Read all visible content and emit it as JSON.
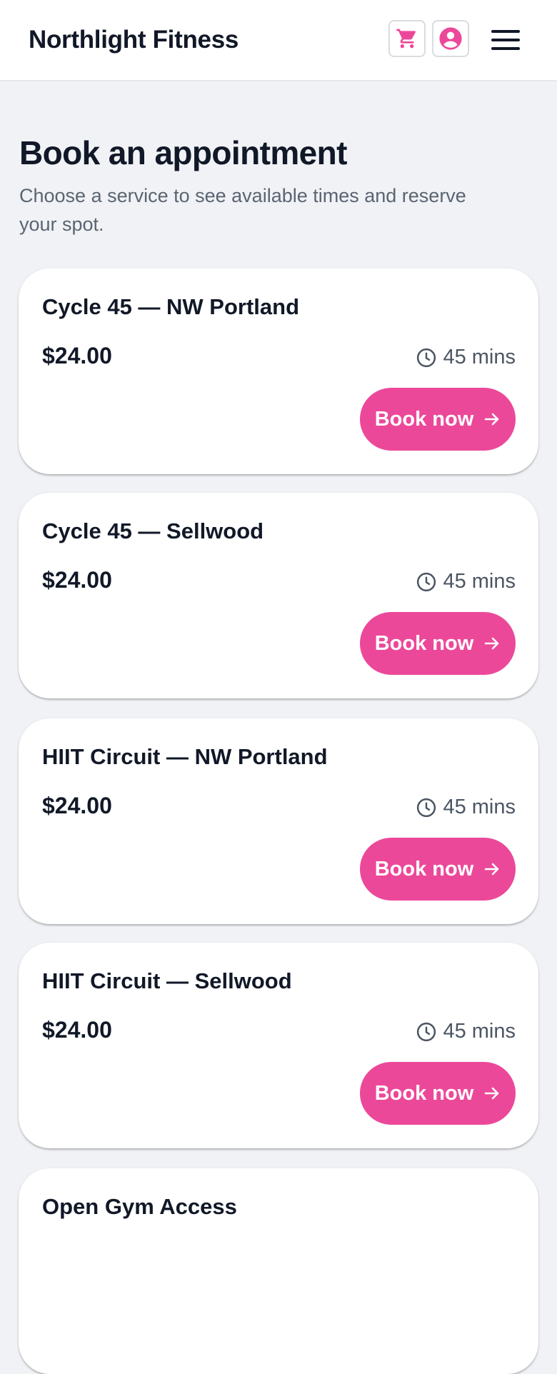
{
  "header": {
    "brand": "Northlight Fitness",
    "cart_icon": "cart-icon",
    "account_icon": "account-circle-icon",
    "menu_icon": "hamburger-menu-icon",
    "accent_color": "#ec4899"
  },
  "page": {
    "title": "Book an appointment",
    "subtitle": "Choose a service to see available times and reserve your spot."
  },
  "services": [
    {
      "title": "Cycle 45 — NW Portland",
      "price": "$24.00",
      "duration": "45 mins",
      "cta": "Book now"
    },
    {
      "title": "Cycle 45 — Sellwood",
      "price": "$24.00",
      "duration": "45 mins",
      "cta": "Book now"
    },
    {
      "title": "HIIT Circuit — NW Portland",
      "price": "$24.00",
      "duration": "45 mins",
      "cta": "Book now"
    },
    {
      "title": "HIIT Circuit — Sellwood",
      "price": "$24.00",
      "duration": "45 mins",
      "cta": "Book now"
    },
    {
      "title": "Open Gym Access"
    }
  ]
}
